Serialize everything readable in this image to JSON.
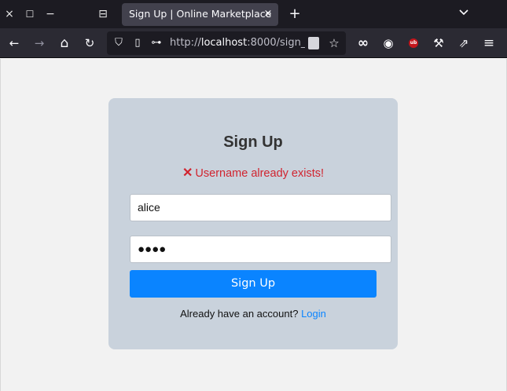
{
  "browser": {
    "window_controls": {
      "close_icon": "×",
      "maximize_icon": "☐",
      "minimize_icon": "−"
    },
    "tab_overview_icon": "⊟",
    "tab": {
      "title": "Sign Up | Online Marketplace",
      "close_icon": "×"
    },
    "new_tab_icon": "+",
    "tab_list_icon": "⌄",
    "toolbar": {
      "back_icon": "←",
      "forward_icon": "→",
      "home_icon": "⌂",
      "reload_icon": "↻",
      "shield_icon": "⛉",
      "page_icon": "▯",
      "key_icon": "⊶",
      "url_host": "http://localhost:8000/sign_",
      "url_prefix": "http://",
      "url_domain": "localhost",
      "url_rest": ":8000/sign_",
      "star_icon": "☆",
      "ext_infinity_icon": "∞",
      "account_icon": "◉",
      "ublock_label": "ub",
      "tools_icon": "⚒",
      "extensions_icon": "⇗",
      "menu_icon": "≡"
    }
  },
  "signup": {
    "title": "Sign Up",
    "error_icon": "✕",
    "error_message": "Username already exists!",
    "username_value": "alice",
    "password_mask": "●●●●",
    "submit_label": "Sign Up",
    "footer_text": "Already have an account?",
    "login_link": "Login"
  },
  "colors": {
    "card_background": "#c9d2dc",
    "error": "#d1242f",
    "primary_button": "#0a84ff",
    "link": "#0a84ff"
  }
}
